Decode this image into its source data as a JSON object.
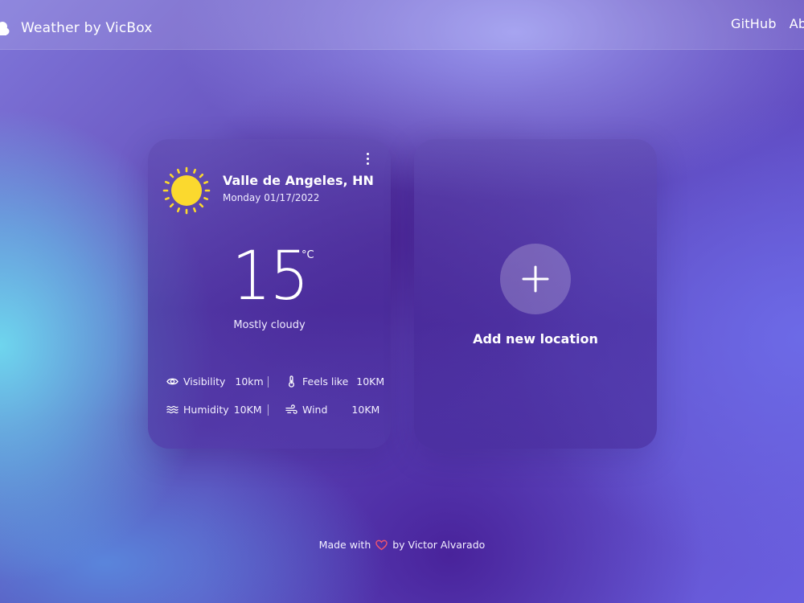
{
  "header": {
    "brand_title": "Weather by VicBox",
    "brand_icon": "cloud-icon",
    "nav": [
      "GitHub",
      "About"
    ]
  },
  "weather_card": {
    "icon": "sun-icon",
    "city": "Valle de Angeles, HN",
    "date": "Monday 01/17/2022",
    "temperature": "15",
    "unit": "°C",
    "description": "Mostly cloudy",
    "stats": {
      "visibility": {
        "label": "Visibility",
        "value": "10km"
      },
      "feels_like": {
        "label": "Feels like",
        "value": "10KM"
      },
      "humidity": {
        "label": "Humidity",
        "value": "10KM"
      },
      "wind": {
        "label": "Wind",
        "value": "10KM"
      }
    }
  },
  "add_card": {
    "label": "Add new location"
  },
  "footer": {
    "made_with": "Made with",
    "by": "by Victor Alvarado"
  },
  "colors": {
    "sun": "#FBD92E",
    "heart": "#F0556E",
    "accent": "#5A3FB5"
  }
}
